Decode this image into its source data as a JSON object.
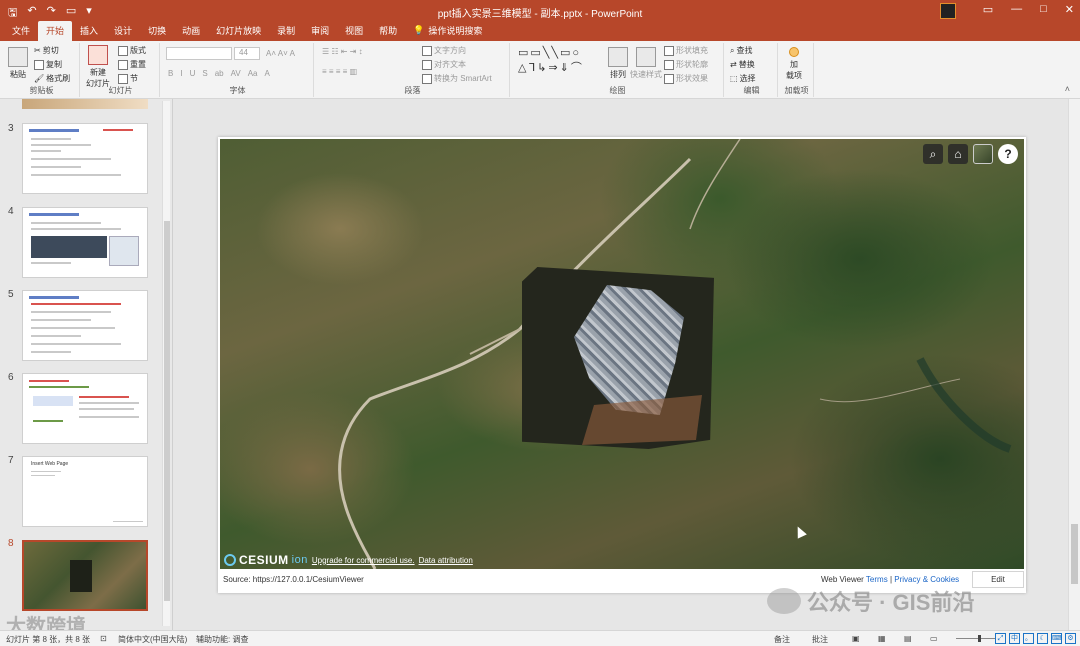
{
  "titlebar": {
    "title": "ppt插入实景三维模型 - 副本.pptx - PowerPoint",
    "qa_icons": [
      "save-icon",
      "undo-icon",
      "redo-icon",
      "present-icon",
      "customize-icon"
    ],
    "win_controls": [
      "—",
      "□",
      "✕"
    ]
  },
  "tabs": {
    "items": [
      "文件",
      "开始",
      "插入",
      "设计",
      "切换",
      "动画",
      "幻灯片放映",
      "录制",
      "审阅",
      "视图",
      "帮助"
    ],
    "search": "操作说明搜索"
  },
  "ribbon": {
    "clipboard": {
      "paste": "粘贴",
      "cut": "剪切",
      "copy": "复制",
      "painter": "格式刷",
      "group": "剪贴板"
    },
    "slides": {
      "new": "新建\n幻灯片",
      "layout": "版式",
      "reset": "重置",
      "section": "节",
      "group": "幻灯片"
    },
    "font": {
      "size": "44",
      "group": "字体",
      "styles": [
        "B",
        "I",
        "U",
        "S",
        "ab",
        "AV",
        "Aa",
        "A"
      ]
    },
    "paragraph": {
      "dir": "文字方向",
      "align": "对齐文本",
      "smartart": "转换为 SmartArt",
      "group": "段落"
    },
    "drawing": {
      "arrange": "排列",
      "quick": "快速样式",
      "fill": "形状填充",
      "outline": "形状轮廓",
      "effect": "形状效果",
      "group": "绘图"
    },
    "editing": {
      "find": "查找",
      "replace": "替换",
      "select": "选择",
      "group": "编辑"
    },
    "addins": {
      "label": "加\n载项",
      "group": "加载项"
    }
  },
  "thumbnails": [
    {
      "num": "3"
    },
    {
      "num": "4"
    },
    {
      "num": "5"
    },
    {
      "num": "6"
    },
    {
      "num": "7",
      "title": "Insert Web Page"
    },
    {
      "num": "8"
    }
  ],
  "viewer": {
    "toolbar": [
      "search-icon",
      "home-icon",
      "layer-picker-icon",
      "help-icon"
    ],
    "help": "?",
    "logo": "CESIUM",
    "logo_ion": "ion",
    "upgrade": "Upgrade for commercial use.",
    "attribution": "Data attribution"
  },
  "footer": {
    "source": "Source: https://127.0.0.1/CesiumViewer",
    "web_viewer": "Web Viewer",
    "terms": "Terms",
    "sep": "|",
    "privacy": "Privacy & Cookies",
    "edit": "Edit"
  },
  "watermark": {
    "text": "公众号 · GIS前沿",
    "left_text": "大数跨境"
  },
  "status": {
    "slide": "幻灯片 第 8 张，共 8 张",
    "lang": "简体中文(中国大陆)",
    "access": "辅助功能: 调查",
    "notes": "备注",
    "comments": "批注",
    "ime": "中",
    "ime2": "。"
  }
}
